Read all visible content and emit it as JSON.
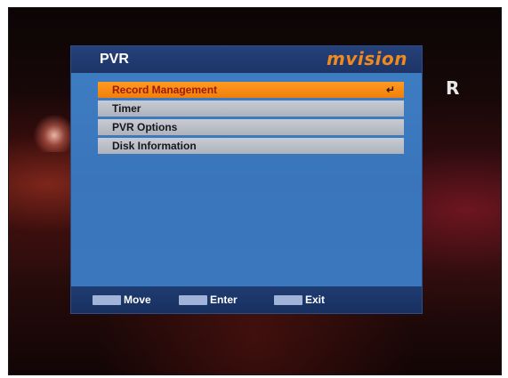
{
  "osd": {
    "title": "PVR",
    "brand": "mvision",
    "menu_items": [
      {
        "label": "Record Management",
        "selected": true
      },
      {
        "label": "Timer",
        "selected": false
      },
      {
        "label": "PVR Options",
        "selected": false
      },
      {
        "label": "Disk Information",
        "selected": false
      }
    ],
    "enter_glyph": "↵",
    "footer": {
      "move_label": "Move",
      "enter_label": "Enter",
      "exit_label": "Exit"
    }
  },
  "channel_logo": "R",
  "colors": {
    "panel": "#3b78be",
    "header": "#1f3c72",
    "selected": "#f58610",
    "item": "#b9bec6",
    "brand": "#f08a1e"
  }
}
